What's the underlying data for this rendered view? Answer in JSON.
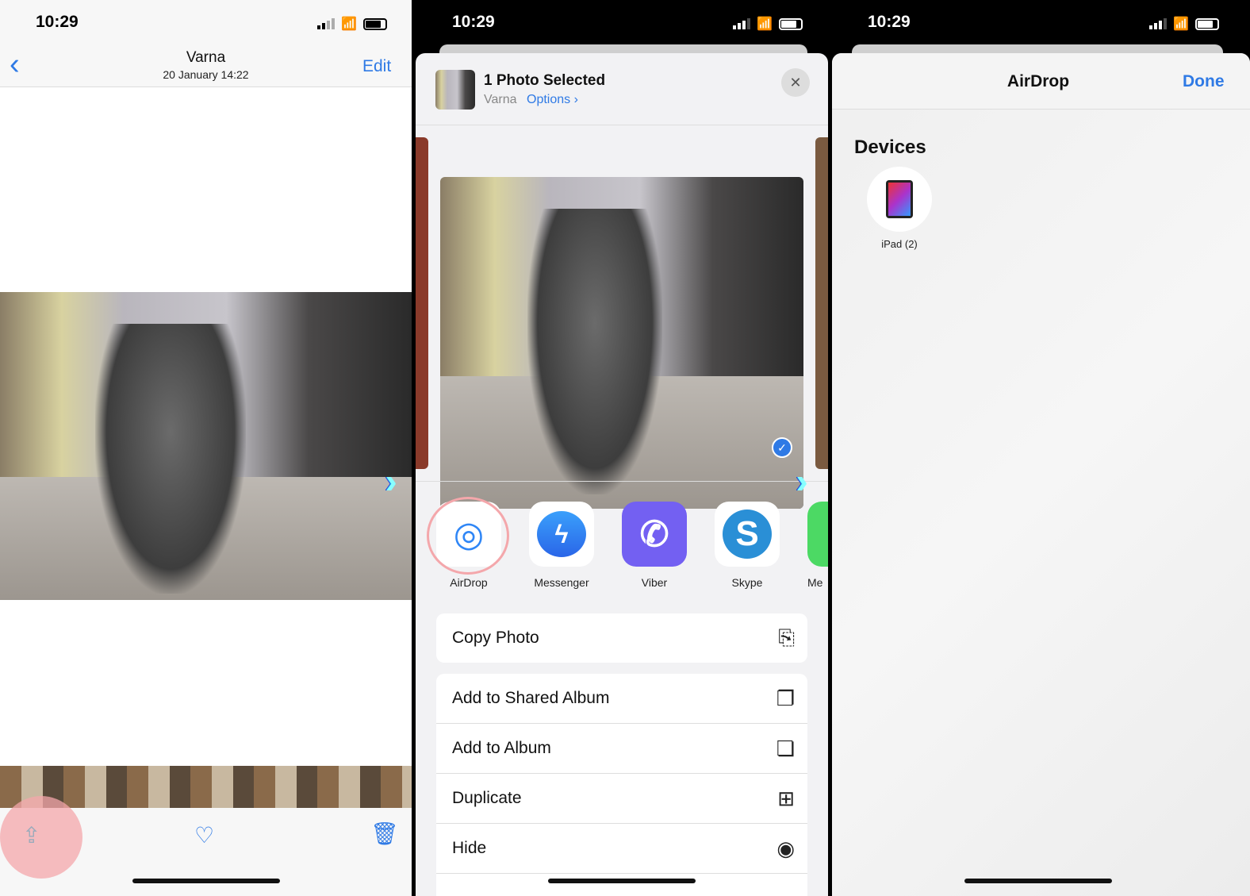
{
  "left": {
    "time": "10:29",
    "title": "Varna",
    "subtitle": "20 January  14:22",
    "edit": "Edit",
    "icons": [
      "chevron-left-icon",
      "share-icon",
      "heart-icon",
      "trash-icon"
    ]
  },
  "middle": {
    "time": "10:29",
    "header_title": "1 Photo Selected",
    "location": "Varna",
    "options": "Options",
    "options_chevron": "›",
    "close": "✕",
    "apps": [
      {
        "label": "AirDrop",
        "color": "#ffffff"
      },
      {
        "label": "Messenger",
        "color": "#2f86f6"
      },
      {
        "label": "Viber",
        "color": "#7360f2"
      },
      {
        "label": "Skype",
        "color": "#2a8fd6"
      },
      {
        "label": "Me",
        "color": "#4cd964"
      }
    ],
    "actions": [
      {
        "label": "Copy Photo",
        "icon": "copy-icon"
      },
      {
        "label": "Add to Shared Album",
        "icon": "shared-album-icon"
      },
      {
        "label": "Add to Album",
        "icon": "add-album-icon"
      },
      {
        "label": "Duplicate",
        "icon": "duplicate-icon"
      },
      {
        "label": "Hide",
        "icon": "eye-slash-icon"
      }
    ]
  },
  "right": {
    "time": "10:29",
    "title": "AirDrop",
    "done": "Done",
    "section": "Devices",
    "device": "iPad (2)"
  },
  "colors": {
    "accent": "#2f7ae5",
    "highlight": "#f4a7ab"
  }
}
